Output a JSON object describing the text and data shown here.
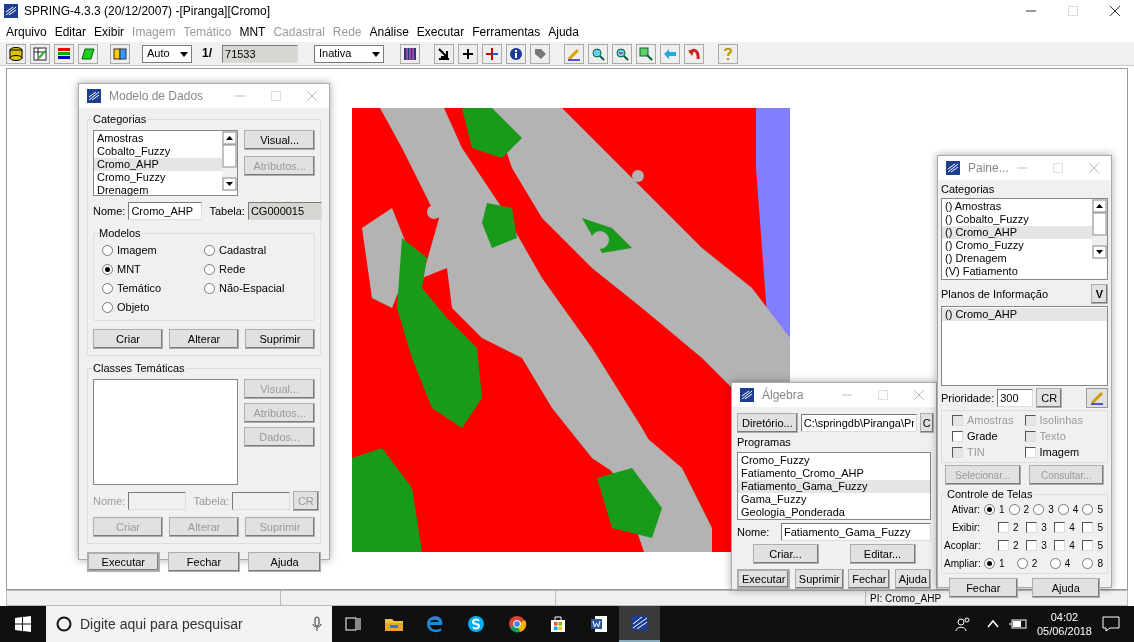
{
  "window": {
    "title": "SPRING-4.3.3 (20/12/2007) -[Piranga][Cromo]"
  },
  "menu": [
    {
      "label": "Arquivo",
      "disabled": false
    },
    {
      "label": "Editar",
      "disabled": false
    },
    {
      "label": "Exibir",
      "disabled": false
    },
    {
      "label": "Imagem",
      "disabled": true
    },
    {
      "label": "Temático",
      "disabled": true
    },
    {
      "label": "MNT",
      "disabled": false
    },
    {
      "label": "Cadastral",
      "disabled": true
    },
    {
      "label": "Rede",
      "disabled": true
    },
    {
      "label": "Análise",
      "disabled": false
    },
    {
      "label": "Executar",
      "disabled": false
    },
    {
      "label": "Ferramentas",
      "disabled": false
    },
    {
      "label": "Ajuda",
      "disabled": false
    }
  ],
  "toolbar": {
    "scale_mode": "Auto",
    "scale_prefix": "1/",
    "scale_value": "71533",
    "cursor_mode": "Inativa"
  },
  "modelo_de_dados": {
    "title": "Modelo de Dados",
    "categorias_label": "Categorias",
    "categorias": [
      {
        "label": "Amostras",
        "selected": false
      },
      {
        "label": "Cobalto_Fuzzy",
        "selected": false
      },
      {
        "label": "Cromo_AHP",
        "selected": true
      },
      {
        "label": "Cromo_Fuzzy",
        "selected": false
      },
      {
        "label": "Drenagem",
        "selected": false
      }
    ],
    "side_buttons": [
      {
        "label": "Visual...",
        "disabled": false
      },
      {
        "label": "Atributos...",
        "disabled": true
      }
    ],
    "nome_label": "Nome:",
    "nome": "Cromo_AHP",
    "tabela_label": "Tabela:",
    "tabela": "CG000015",
    "modelos_label": "Modelos",
    "modelos": [
      {
        "label": "Imagem",
        "selected": false
      },
      {
        "label": "Cadastral",
        "selected": false
      },
      {
        "label": "MNT",
        "selected": true
      },
      {
        "label": "Rede",
        "selected": false
      },
      {
        "label": "Temático",
        "selected": false
      },
      {
        "label": "Não-Espacial",
        "selected": false
      },
      {
        "label": "Objeto",
        "selected": false
      }
    ],
    "actions": [
      {
        "label": "Criar",
        "disabled": false
      },
      {
        "label": "Alterar",
        "disabled": false
      },
      {
        "label": "Suprimir",
        "disabled": false
      }
    ],
    "classes_label": "Classes Temáticas",
    "classes_buttons": [
      {
        "label": "Visual...",
        "disabled": true
      },
      {
        "label": "Atributos...",
        "disabled": true
      },
      {
        "label": "Dados...",
        "disabled": true
      }
    ],
    "classes_nome_label": "Nome:",
    "classes_tabela_label": "Tabela:",
    "classes_cr": "CR",
    "classes_actions": [
      {
        "label": "Criar",
        "disabled": true
      },
      {
        "label": "Alterar",
        "disabled": true
      },
      {
        "label": "Suprimir",
        "disabled": true
      }
    ],
    "footer": [
      "Executar",
      "Fechar",
      "Ajuda"
    ]
  },
  "algebra": {
    "title": "Álgebra",
    "diretorio_button": "Diretório...",
    "diretorio": "C:\\springdb\\Piranga\\Pr",
    "cr_button": "C",
    "programas_label": "Programas",
    "programas": [
      {
        "label": "Cromo_Fuzzy",
        "selected": false
      },
      {
        "label": "Fatiamento_Cromo_AHP",
        "selected": false
      },
      {
        "label": "Fatiamento_Gama_Fuzzy",
        "selected": true
      },
      {
        "label": "Gama_Fuzzy",
        "selected": false
      },
      {
        "label": "Geologia_Ponderada",
        "selected": false
      }
    ],
    "nome_label": "Nome:",
    "nome": "Fatiamento_Gama_Fuzzy",
    "buttons": [
      "Criar...",
      "Editar..."
    ],
    "footer": [
      "Executar",
      "Suprimir",
      "Fechar",
      "Ajuda"
    ]
  },
  "painel": {
    "title": "Paine...",
    "categorias_label": "Categorias",
    "categorias": [
      {
        "label": "() Amostras",
        "selected": false
      },
      {
        "label": "() Cobalto_Fuzzy",
        "selected": false
      },
      {
        "label": "() Cromo_AHP",
        "selected": true
      },
      {
        "label": "() Cromo_Fuzzy",
        "selected": false
      },
      {
        "label": "() Drenagem",
        "selected": false
      },
      {
        "label": "(V) Fatiamento",
        "selected": false
      }
    ],
    "planos_label": "Planos de Informação",
    "planos_button": "V",
    "planos": [
      {
        "label": "() Cromo_AHP",
        "selected": true
      }
    ],
    "prioridade_label": "Prioridade:",
    "prioridade": "300",
    "cr_button": "CR",
    "representacoes": [
      {
        "label": "Amostras",
        "checked": false,
        "disabled": true
      },
      {
        "label": "Isolinhas",
        "checked": false,
        "disabled": true
      },
      {
        "label": "Grade",
        "checked": false,
        "disabled": false
      },
      {
        "label": "Texto",
        "checked": false,
        "disabled": true
      },
      {
        "label": "TIN",
        "checked": false,
        "disabled": true
      },
      {
        "label": "Imagem",
        "checked": false,
        "disabled": false
      }
    ],
    "query_buttons": [
      {
        "label": "Selecionar...",
        "disabled": true
      },
      {
        "label": "Consultar...",
        "disabled": true
      }
    ],
    "controle_label": "Controle de Telas",
    "controle": [
      {
        "label": "Ativar:",
        "kind": "radio",
        "options": [
          {
            "label": "1",
            "selected": true
          },
          {
            "label": "2",
            "selected": false
          },
          {
            "label": "3",
            "selected": false
          },
          {
            "label": "4",
            "selected": false
          },
          {
            "label": "5",
            "selected": false
          }
        ]
      },
      {
        "label": "Exibir:",
        "kind": "checkbox",
        "options": [
          {
            "label": "2",
            "checked": false
          },
          {
            "label": "3",
            "checked": false
          },
          {
            "label": "4",
            "checked": false
          },
          {
            "label": "5",
            "checked": false
          }
        ]
      },
      {
        "label": "Acoplar:",
        "kind": "checkbox",
        "options": [
          {
            "label": "2",
            "checked": false
          },
          {
            "label": "3",
            "checked": false
          },
          {
            "label": "4",
            "checked": false
          },
          {
            "label": "5",
            "checked": false
          }
        ]
      },
      {
        "label": "Ampliar:",
        "kind": "radio",
        "options": [
          {
            "label": "1",
            "selected": true
          },
          {
            "label": "2",
            "selected": false
          },
          {
            "label": "4",
            "selected": false
          },
          {
            "label": "8",
            "selected": false
          }
        ]
      }
    ],
    "footer": [
      "Fechar",
      "Ajuda"
    ]
  },
  "status_bar": {
    "plane": "PI: Cromo_AHP"
  },
  "taskbar": {
    "search_placeholder": "Digite aqui para pesquisar",
    "time": "04:02",
    "date": "05/06/2018"
  }
}
